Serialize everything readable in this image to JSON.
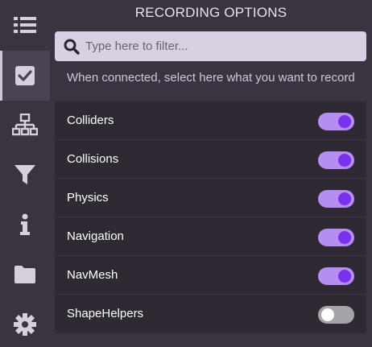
{
  "sidebar": {
    "items": [
      {
        "icon": "list-icon",
        "active": false
      },
      {
        "icon": "checkbox-icon",
        "active": true
      },
      {
        "icon": "network-icon",
        "active": false
      },
      {
        "icon": "filter-icon",
        "active": false
      },
      {
        "icon": "info-icon",
        "active": false
      },
      {
        "icon": "folder-icon",
        "active": false
      },
      {
        "icon": "gear-icon",
        "active": false
      }
    ]
  },
  "header": {
    "title": "RECORDING OPTIONS"
  },
  "search": {
    "placeholder": "Type here to filter...",
    "value": ""
  },
  "hint": "When connected, select here what you want to record",
  "options": [
    {
      "label": "Colliders",
      "enabled": true
    },
    {
      "label": "Collisions",
      "enabled": true
    },
    {
      "label": "Physics",
      "enabled": true
    },
    {
      "label": "Navigation",
      "enabled": true
    },
    {
      "label": "NavMesh",
      "enabled": true
    },
    {
      "label": "ShapeHelpers",
      "enabled": false
    }
  ],
  "colors": {
    "background": "#3a3440",
    "panel": "#2e2933",
    "toggle_on_track": "#b48ef0",
    "toggle_on_knob": "#7b2ff0",
    "toggle_off_track": "#a7a3ab"
  }
}
